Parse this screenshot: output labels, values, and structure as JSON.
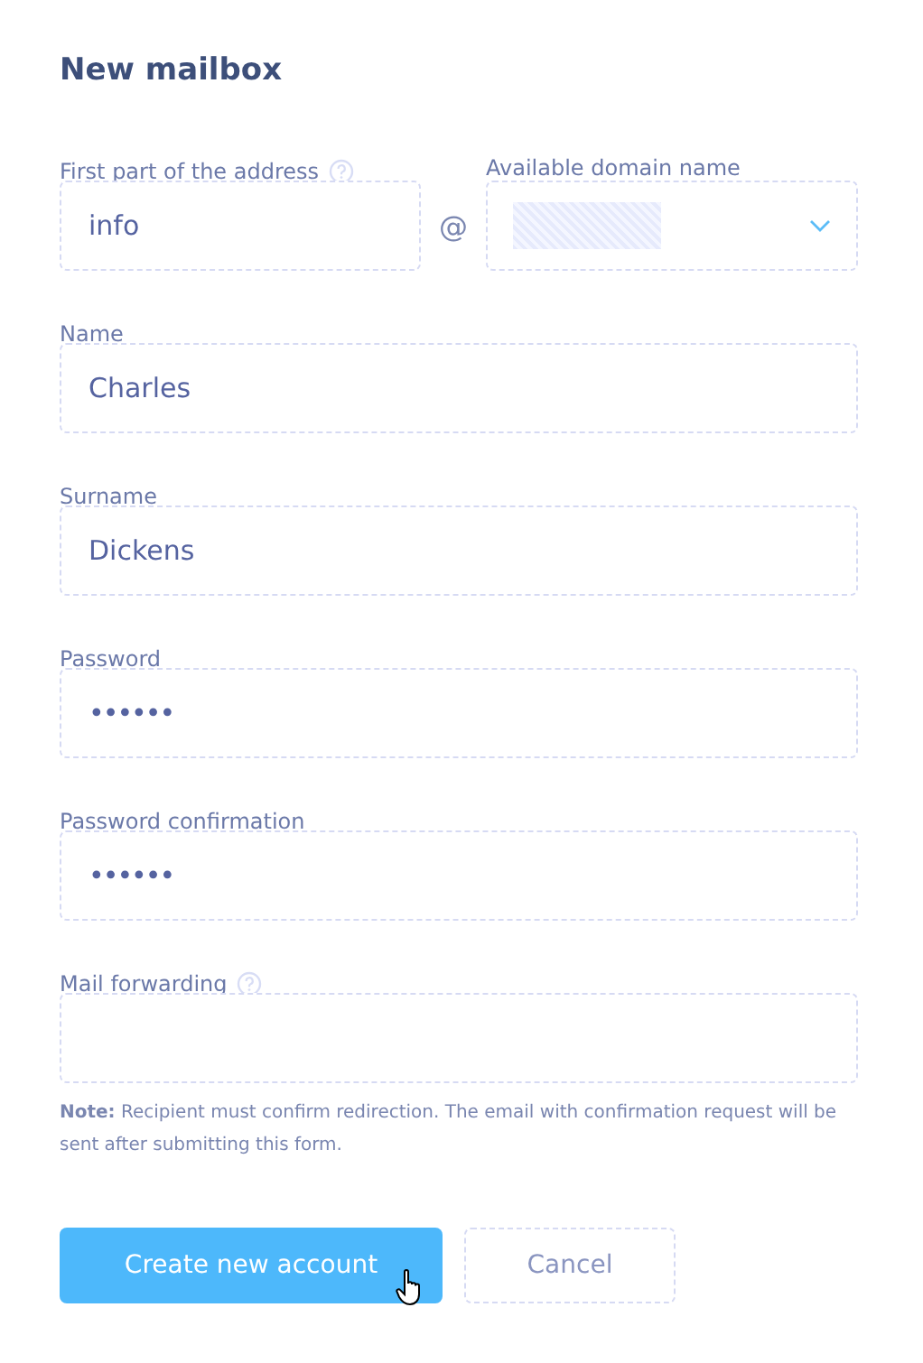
{
  "title": "New mailbox",
  "address": {
    "label": "First part of the address",
    "help": true,
    "value": "info",
    "separator": "@",
    "domain_label": "Available domain name",
    "domain_redacted": true
  },
  "fields": [
    {
      "label": "Name",
      "kind": "text",
      "value": "Charles",
      "help": false
    },
    {
      "label": "Surname",
      "kind": "text",
      "value": "Dickens",
      "help": false
    },
    {
      "label": "Password",
      "kind": "password",
      "value": "••••••",
      "help": false
    },
    {
      "label": "Password confirmation",
      "kind": "password",
      "value": "••••••",
      "help": false
    },
    {
      "label": "Mail forwarding",
      "kind": "text",
      "help": true
    }
  ],
  "note": "**Note:** Recipient must confirm redirection. The email with confirmation request will be sent after submitting this form.",
  "buttons": [
    {
      "label": "Create new account",
      "kind": "primary",
      "hovered": true
    },
    {
      "label": "Cancel",
      "kind": "secondary",
      "hovered": false
    }
  ]
}
